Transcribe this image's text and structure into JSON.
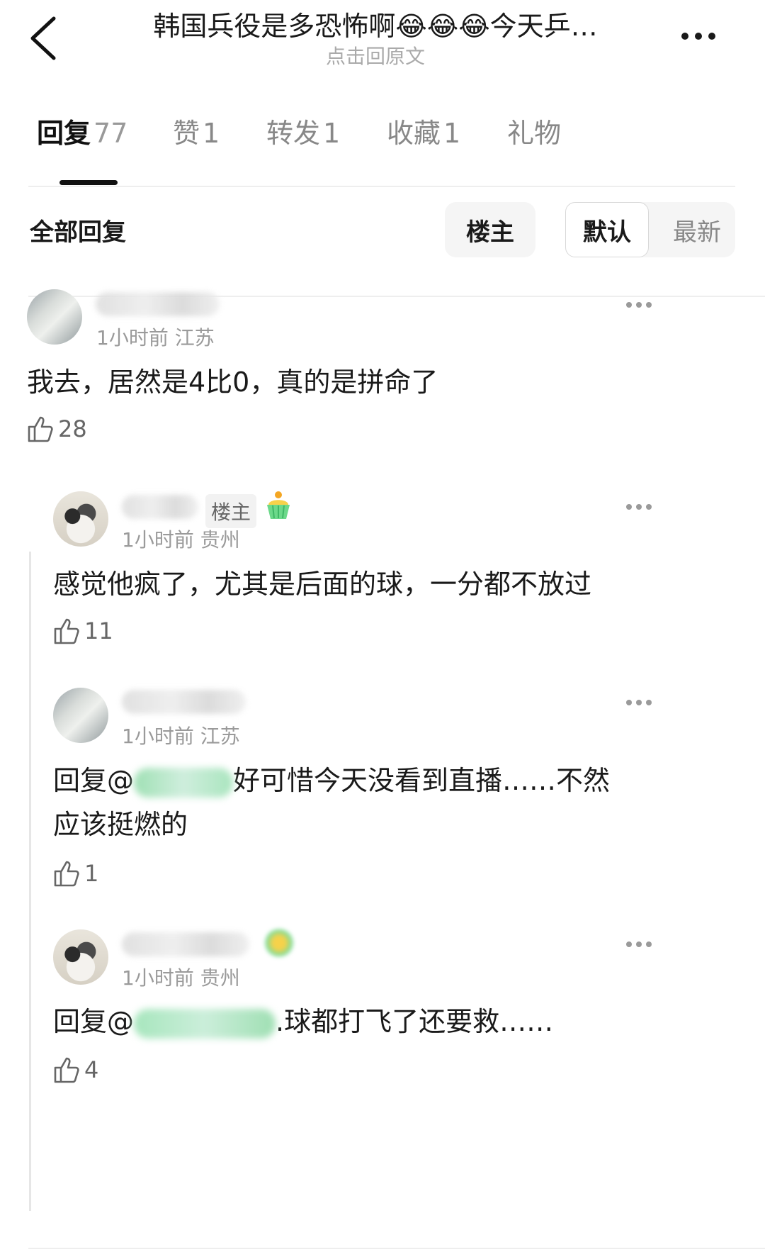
{
  "header": {
    "title": "韩国兵役是多恐怖啊😂😂😂今天乒…",
    "subtitle": "点击回原文"
  },
  "tabs": [
    {
      "label": "回复",
      "count": "77"
    },
    {
      "label": "赞",
      "count": "1"
    },
    {
      "label": "转发",
      "count": "1"
    },
    {
      "label": "收藏",
      "count": "1"
    },
    {
      "label": "礼物",
      "count": ""
    }
  ],
  "filter": {
    "all_label": "全部回复",
    "op_label": "楼主",
    "sort_default": "默认",
    "sort_latest": "最新"
  },
  "comments": [
    {
      "meta": "1小时前 江苏",
      "text": "我去，居然是4比0，真的是拼命了",
      "likes": "28"
    },
    {
      "meta": "1小时前 贵州",
      "badge": "楼主",
      "text": "感觉他疯了，尤其是后面的球，一分都不放过",
      "likes": "11"
    },
    {
      "meta": "1小时前 江苏",
      "reply_prefix": "回复@",
      "text": "好可惜今天没看到直播……不然应该挺燃的",
      "likes": "1"
    },
    {
      "meta": "1小时前 贵州",
      "reply_prefix": "回复@",
      "text": ".球都打飞了还要救……",
      "likes": "4"
    }
  ],
  "colors": {
    "accent": "#111111",
    "muted": "#9a9a9a",
    "divider": "#eeeeee"
  }
}
